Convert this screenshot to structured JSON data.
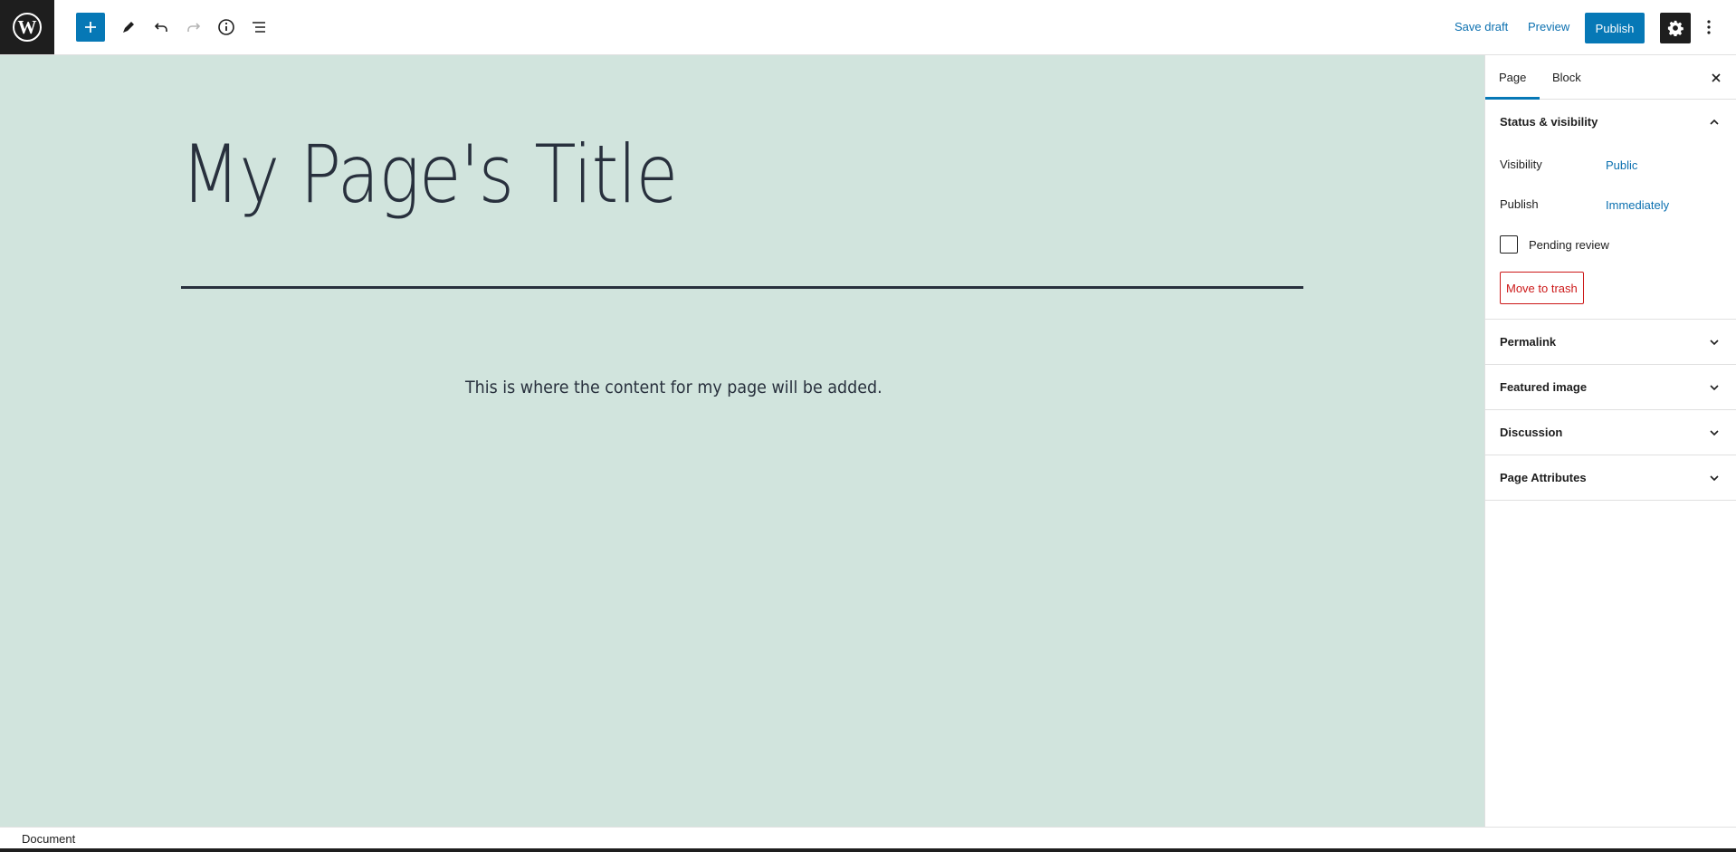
{
  "toolbar": {
    "save_draft": "Save draft",
    "preview": "Preview",
    "publish": "Publish"
  },
  "editor": {
    "title": "My Page's Title",
    "paragraph": "This is where the content for my page will be added."
  },
  "sidebar": {
    "tabs": [
      {
        "label": "Page",
        "active": true
      },
      {
        "label": "Block",
        "active": false
      }
    ],
    "status": {
      "title": "Status & visibility",
      "visibility_label": "Visibility",
      "visibility_value": "Public",
      "publish_label": "Publish",
      "publish_value": "Immediately",
      "pending_review": "Pending review",
      "pending_checked": false,
      "trash": "Move to trash"
    },
    "panels": [
      {
        "label": "Permalink"
      },
      {
        "label": "Featured image"
      },
      {
        "label": "Discussion"
      },
      {
        "label": "Page Attributes"
      }
    ]
  },
  "footer": {
    "breadcrumb": "Document"
  },
  "colors": {
    "accent": "#0678b6",
    "canvas_bg": "#d1e4dd",
    "danger": "#cc1818",
    "dark": "#1e1e1e"
  }
}
